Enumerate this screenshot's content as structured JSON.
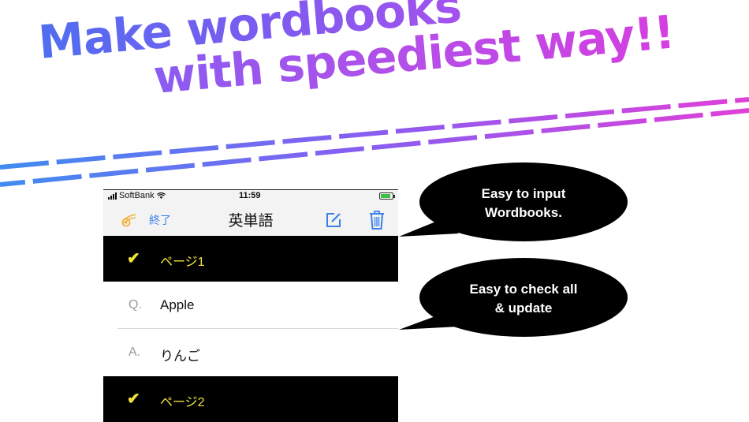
{
  "headline": {
    "line1": "Make wordbooks",
    "line2": "with  speediest way!!",
    "gradient_start": "#4f6ef0",
    "gradient_end": "#d63ee0"
  },
  "phone": {
    "status_bar": {
      "carrier": "SoftBank",
      "time": "11:59"
    },
    "nav": {
      "done_label": "終了",
      "title": "英単語",
      "left_icon": "comet-icon",
      "compose_icon": "compose-icon",
      "trash_icon": "trash-icon"
    },
    "pages": [
      {
        "check": "✔",
        "label": "ページ1"
      },
      {
        "check": "✔",
        "label": "ページ2"
      }
    ],
    "entries": [
      {
        "mark": "Q.",
        "text": "Apple"
      },
      {
        "mark": "A.",
        "text": "りんご"
      }
    ],
    "accent_color": "#f2e33a",
    "link_color": "#3b82e8"
  },
  "callouts": [
    {
      "line1": "Easy to input",
      "line2": "Wordbooks."
    },
    {
      "line1": "Easy to check all",
      "line2": "& update"
    }
  ]
}
